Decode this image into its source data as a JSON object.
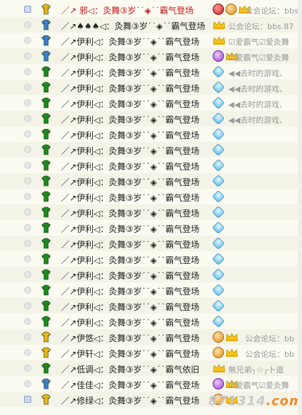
{
  "rows": [
    {
      "name": "／↗  邪◁：灸舞③岁˙˙◈˙˙霸气登场",
      "sig": "公会论坛：bbs",
      "red": true,
      "lead": "sq",
      "badges": [
        "red",
        "orange",
        "crown"
      ],
      "sigLeft": "far"
    },
    {
      "name": "／↗♠♠♠◁：灸舞③岁˙˙◈˙˙霸气登场",
      "sig": "公会论坛：bbs.87",
      "lead": "dot",
      "badges": [
        "crown"
      ],
      "sigLeft": "near"
    },
    {
      "name": "／↗伊利◁：灸舞③岁˙˙◈˙˙霸气登场",
      "sig": "☑爱霸气☑爱灸舞",
      "lead": "dot",
      "badges": [
        "crown"
      ],
      "sigLeft": "near"
    },
    {
      "name": "／↗伊利◁：灸舞③岁˙˙◈˙˙霸气登场",
      "sig": "☑爱霸气☑爱灸舞",
      "lead": "dot",
      "badges": [
        "purple",
        "crown"
      ],
      "sigLeft": "near"
    },
    {
      "name": "／↗伊利◁：灸舞③岁˙˙◈˙˙霸气登场",
      "sig": "◀◀去时的游戏、",
      "lead": "dot",
      "badges": [
        "gem"
      ],
      "sigLeft": "near"
    },
    {
      "name": "／↗伊利◁：灸舞③岁˙˙◈˙˙霸气登场",
      "sig": "◀◀去时的游戏、",
      "lead": "dot",
      "badges": [
        "gem"
      ],
      "sigLeft": "near"
    },
    {
      "name": "／↗伊利◁：灸舞③岁˙˙◈˙˙霸气登场",
      "sig": "◀◀去时的游戏、",
      "lead": "dot",
      "badges": [
        "gem"
      ],
      "sigLeft": "near"
    },
    {
      "name": "／↗伊利◁：灸舞③岁˙˙◈˙˙霸气登场",
      "sig": "◀◀去时的游戏、",
      "lead": "dot",
      "badges": [
        "gem"
      ],
      "sigLeft": "near"
    },
    {
      "name": "／↗伊利◁：灸舞③岁˙˙◈˙˙霸气登场",
      "sig": "",
      "lead": "dot",
      "badges": [
        "gem"
      ],
      "sigLeft": "near"
    },
    {
      "name": "／↗伊利◁：灸舞③岁˙˙◈˙˙霸气登场",
      "sig": "",
      "lead": "dot",
      "badges": [
        "gem"
      ],
      "sigLeft": "near"
    },
    {
      "name": "／↗伊利◁：灸舞③岁˙˙◈˙˙霸气登场",
      "sig": "",
      "lead": "dot",
      "badges": [
        "gem"
      ],
      "sigLeft": "near"
    },
    {
      "name": "／↗伊利◁：灸舞③岁˙˙◈˙˙霸气登场",
      "sig": "",
      "lead": "dot",
      "badges": [
        "gem"
      ],
      "sigLeft": "near"
    },
    {
      "name": "／↗伊利◁：灸舞③岁˙˙◈˙˙霸气登场",
      "sig": "",
      "lead": "dot",
      "badges": [
        "gem"
      ],
      "sigLeft": "near"
    },
    {
      "name": "／↗伊利◁：灸舞③岁˙˙◈˙˙霸气登场",
      "sig": "",
      "lead": "dot",
      "badges": [
        "gem"
      ],
      "sigLeft": "near"
    },
    {
      "name": "／↗伊利◁：灸舞③岁˙˙◈˙˙霸气登场",
      "sig": "",
      "lead": "dot",
      "badges": [
        "gem"
      ],
      "sigLeft": "near"
    },
    {
      "name": "／↗伊利◁：灸舞③岁˙˙◈˙˙霸气登场",
      "sig": "",
      "lead": "dot",
      "badges": [
        "gem"
      ],
      "sigLeft": "near"
    },
    {
      "name": "／↗伊利◁：灸舞③岁˙˙◈˙˙霸气登场",
      "sig": "",
      "lead": "dot",
      "badges": [
        "gem"
      ],
      "sigLeft": "near"
    },
    {
      "name": "／↗伊利◁：灸舞③岁˙˙◈˙˙霸气登场",
      "sig": "",
      "lead": "dot",
      "badges": [
        "gem"
      ],
      "sigLeft": "near"
    },
    {
      "name": "／↗伊利◁：灸舞③岁˙˙◈˙˙霸气登场",
      "sig": "",
      "lead": "dot",
      "badges": [
        "gem"
      ],
      "sigLeft": "near"
    },
    {
      "name": "／↗伊利◁：灸舞③岁˙˙◈˙˙霸气登场",
      "sig": "",
      "lead": "dot",
      "badges": [
        "gem"
      ],
      "sigLeft": "near"
    },
    {
      "name": "／↗伊利◁：灸舞③岁˙˙◈˙˙霸气登场",
      "sig": "",
      "lead": "dot",
      "badges": [
        "gem"
      ],
      "sigLeft": "near"
    },
    {
      "name": "／↗伊悠◁：灸舞③岁˙˙◈˙˙霸气登场",
      "sig": "公会论坛：bb",
      "lead": "dot",
      "badges": [
        "orange",
        "crown"
      ],
      "sigLeft": "far"
    },
    {
      "name": "／↗伊轩◁：灸舞③岁˙˙◈˙˙霸气登场",
      "sig": "公会论坛：bb",
      "lead": "dot",
      "badges": [
        "orange",
        "crown"
      ],
      "sigLeft": "far"
    },
    {
      "name": "／↗低调◁：灸舞③岁˙˙◈˙˙霸气依旧",
      "sig": "無兄弟╮☆╭卜道",
      "lead": "dot",
      "badges": [
        "crown"
      ],
      "sigLeft": "near"
    },
    {
      "name": "／↗佳佳◁：灸舞③岁˙˙◈˙˙霸气登场",
      "sig": "☑爱霸气☑爱灸舞",
      "lead": "dot",
      "badges": [
        "purple",
        "crown"
      ],
      "sigLeft": "near"
    },
    {
      "name": "／↗修绿◁：灸舞③岁˙˙◈˙˙霸气登场",
      "sig": "",
      "lead": "sq",
      "badges": [
        "orange",
        "crown"
      ],
      "sigLeft": "near"
    }
  ],
  "watermark": {
    "text": "871314",
    "suffix": ".com"
  },
  "colors": {
    "avatar_green": "#1f8a1f",
    "avatar_yellow": "#e8b21a",
    "avatar_blue": "#3d7fc6",
    "name_red": "#c01818"
  }
}
